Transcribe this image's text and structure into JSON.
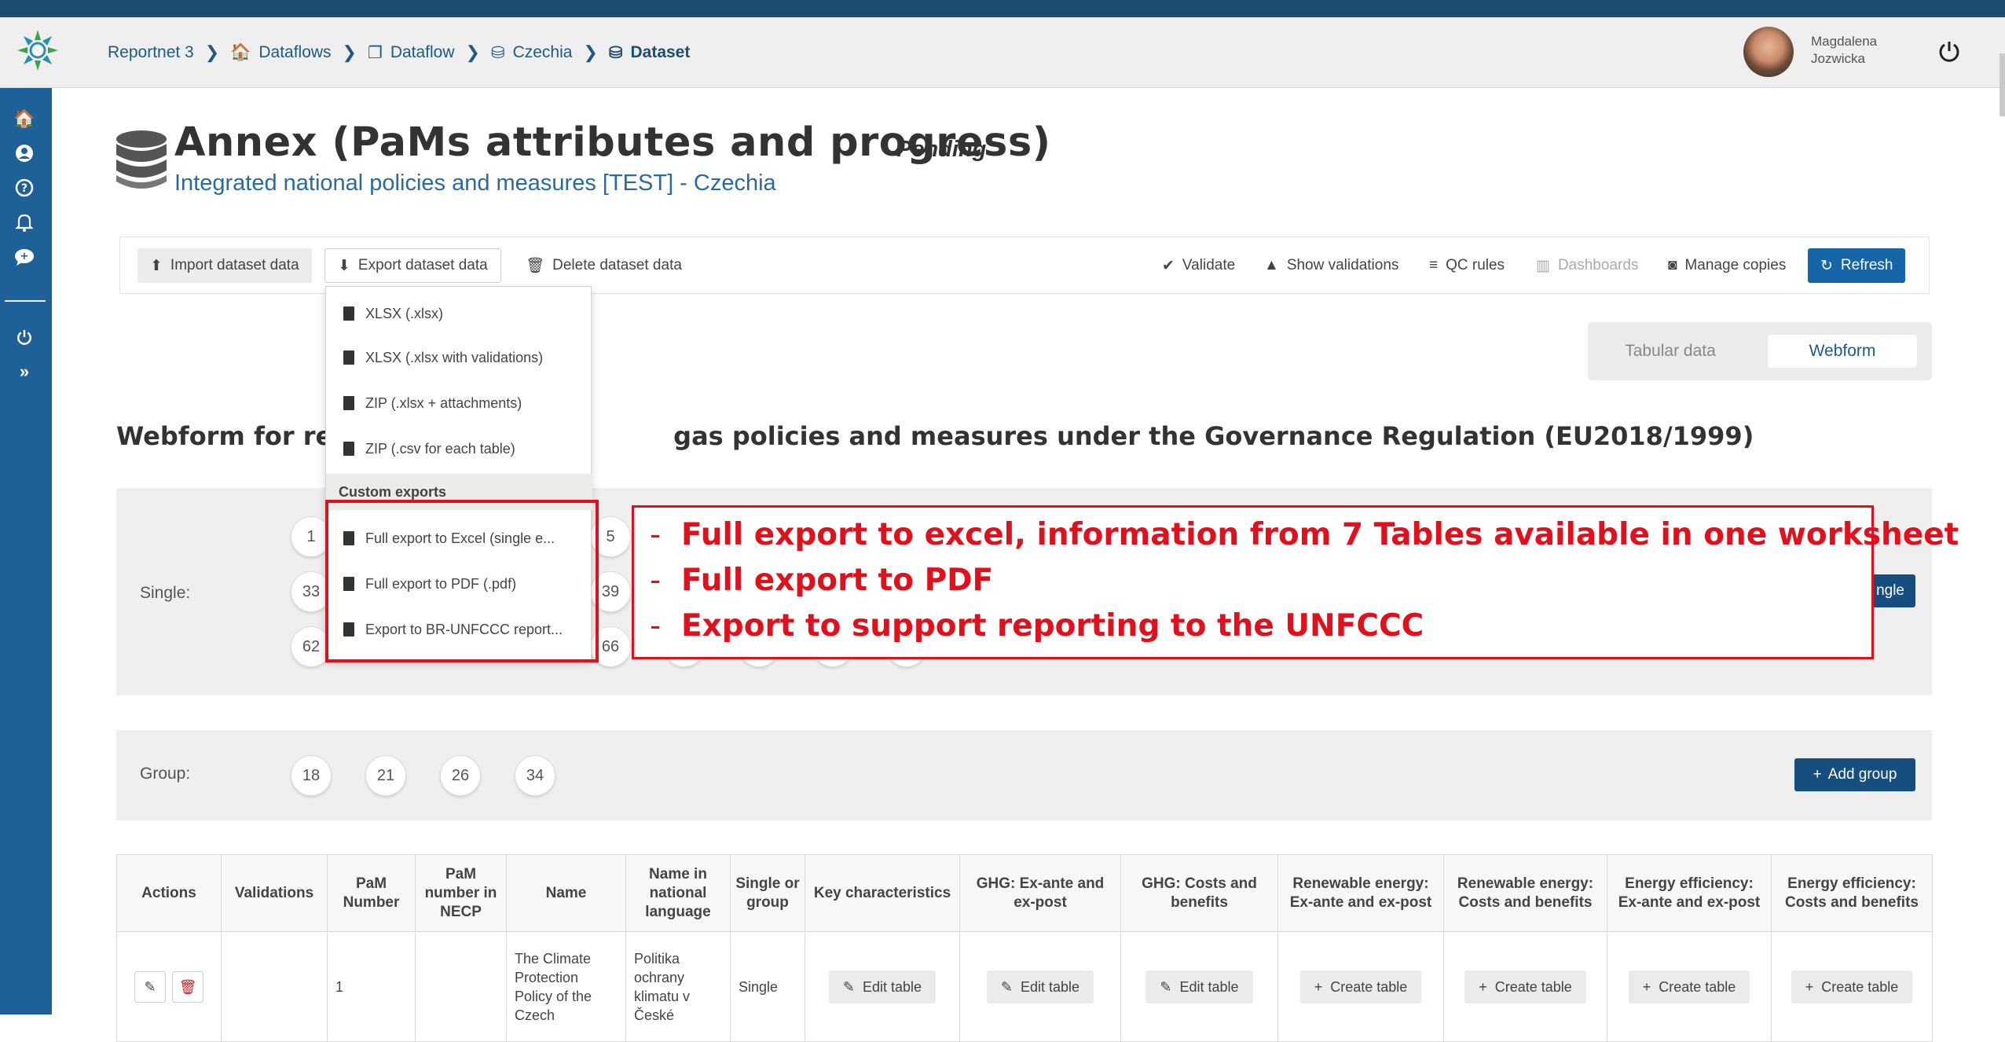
{
  "header": {
    "breadcrumbs": [
      {
        "label": "Reportnet 3"
      },
      {
        "label": "Dataflows"
      },
      {
        "label": "Dataflow"
      },
      {
        "label": "Czechia"
      },
      {
        "label": "Dataset"
      }
    ],
    "user": {
      "first": "Magdalena",
      "last": "Jozwicka"
    }
  },
  "dataset": {
    "title": "Annex (PaMs attributes and progress)",
    "status": "Pending",
    "subtitle": "Integrated national policies and measures [TEST] - Czechia"
  },
  "toolbar": {
    "import": "Import dataset data",
    "export": "Export dataset data",
    "delete": "Delete dataset data",
    "validate": "Validate",
    "show_validations": "Show validations",
    "qc_rules": "QC rules",
    "dashboards": "Dashboards",
    "manage_copies": "Manage copies",
    "refresh": "Refresh"
  },
  "export_menu": {
    "items": [
      "XLSX (.xlsx)",
      "XLSX (.xlsx with validations)",
      "ZIP (.xlsx + attachments)",
      "ZIP (.csv for each table)"
    ],
    "section": "Custom exports",
    "custom": [
      "Full export to Excel (single e...",
      "Full export to PDF (.pdf)",
      "Export to BR-UNFCCC report..."
    ]
  },
  "view_tabs": {
    "tabular": "Tabular data",
    "webform": "Webform"
  },
  "webform": {
    "heading": "Webform for reporting on greenhouse gas policies and measures under the Governance Regulation (EU2018/1999)",
    "heading_visible_left": "Webform for rep",
    "heading_visible_right": "gas policies and measures under the Governance Regulation (EU2018/1999)",
    "single_label": "Single:",
    "single_visible": [
      "1",
      "5",
      "33",
      "39",
      "62",
      "66"
    ],
    "add_single_partial": "ngle",
    "group_label": "Group:",
    "group_numbers": [
      "18",
      "21",
      "26",
      "34"
    ],
    "add_group": "Add group"
  },
  "callout": {
    "lines": [
      "Full export to excel, information from 7 Tables available in one worksheet",
      "Full export to PDF",
      "Export to support reporting to the UNFCCC"
    ],
    "dash": "-"
  },
  "table": {
    "headers": [
      "Actions",
      "Validations",
      "PaM Number",
      "PaM number in NECP",
      "Name",
      "Name in national language",
      "Single or group",
      "Key characteristics",
      "GHG: Ex-ante and ex-post",
      "GHG: Costs and benefits",
      "Renewable energy: Ex-ante and ex-post",
      "Renewable energy: Costs and benefits",
      "Energy efficiency: Ex-ante and ex-post",
      "Energy efficiency: Costs and benefits"
    ],
    "row": {
      "pam_number": "1",
      "name": "The Climate Protection Policy of the Czech",
      "name_national": "Politika ochrany klimatu v České",
      "single_or_group": "Single",
      "edit_table": "Edit table",
      "create_table": "Create table"
    }
  },
  "colors": {
    "primary": "#164e7f",
    "highlight": "#e0101c",
    "sidebar": "#1e6098"
  }
}
